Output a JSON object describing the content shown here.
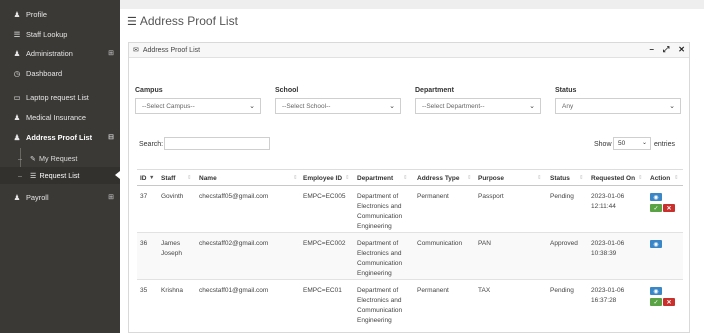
{
  "sidebar": {
    "items": [
      {
        "label": "Profile",
        "icon": "user-icon"
      },
      {
        "label": "Staff Lookup",
        "icon": "list-icon"
      },
      {
        "label": "Administration",
        "icon": "user-icon",
        "expand": "⊞"
      },
      {
        "label": "Dashboard",
        "icon": "clock-icon"
      },
      {
        "label": "Laptop request List",
        "icon": "laptop-icon"
      },
      {
        "label": "Medical Insurance",
        "icon": "user-icon"
      },
      {
        "label": "Address Proof List",
        "icon": "user-icon",
        "expand": "⊟"
      },
      {
        "label": "Payroll",
        "icon": "user-icon",
        "expand": "⊞"
      }
    ],
    "subitems": [
      {
        "label": "My Request",
        "icon": "edit-icon"
      },
      {
        "label": "Request List",
        "icon": "list-icon"
      }
    ]
  },
  "page": {
    "title": "Address Proof List"
  },
  "panel": {
    "title": "Address Proof List"
  },
  "filters": {
    "campus": {
      "label": "Campus",
      "value": "--Select Campus--"
    },
    "school": {
      "label": "School",
      "value": "--Select School--"
    },
    "department": {
      "label": "Department",
      "value": "--Select Department--"
    },
    "status": {
      "label": "Status",
      "value": "Any"
    }
  },
  "table_controls": {
    "search_label": "Search:",
    "show_label": "Show",
    "show_value": "50",
    "entries_label": "entries"
  },
  "table": {
    "columns": [
      "ID",
      "Staff",
      "Name",
      "Employee ID",
      "Department",
      "Address Type",
      "Purpose",
      "Status",
      "Requested On",
      "Action"
    ],
    "rows": [
      {
        "id": "37",
        "staff": "Govinth",
        "name": "checstaff05@gmail.com",
        "employee_id": "EMPC=EC005",
        "department": "Department of Electronics and Communication Engineering",
        "address_type": "Permanent",
        "purpose": "Passport",
        "status": "Pending",
        "requested_on": "2023-01-06 12:11:44"
      },
      {
        "id": "36",
        "staff": "James Joseph",
        "name": "checstaff02@gmail.com",
        "employee_id": "EMPC=EC002",
        "department": "Department of Electronics and Communication Engineering",
        "address_type": "Communication",
        "purpose": "PAN",
        "status": "Approved",
        "requested_on": "2023-01-06 10:38:39"
      },
      {
        "id": "35",
        "staff": "Krishna",
        "name": "checstaff01@gmail.com",
        "employee_id": "EMPC=EC01",
        "department": "Department of Electronics and Communication Engineering",
        "address_type": "Permanent",
        "purpose": "TAX",
        "status": "Pending",
        "requested_on": "2023-01-06 16:37:28"
      }
    ]
  },
  "colors": {
    "sidebar_bg": "#3b3936",
    "view_button": "#3a87c8",
    "approve_button": "#5aa345",
    "reject_button": "#c9302c"
  }
}
